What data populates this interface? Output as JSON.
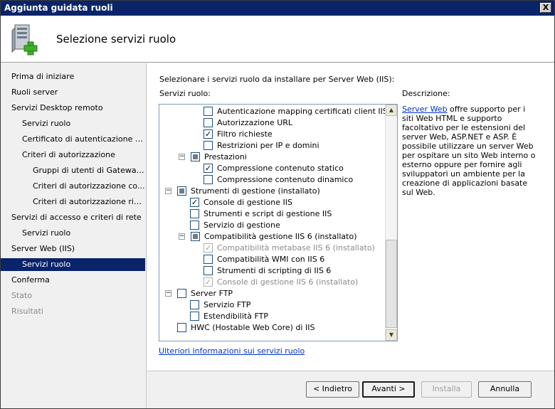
{
  "window": {
    "title": "Aggiunta guidata ruoli",
    "close_glyph": "X"
  },
  "header": {
    "title": "Selezione servizi ruolo",
    "icon": "server-add-icon"
  },
  "nav": {
    "items": [
      {
        "label": "Prima di iniziare",
        "state": "normal"
      },
      {
        "label": "Ruoli server",
        "state": "normal"
      },
      {
        "label": "Servizi Desktop remoto",
        "state": "normal"
      },
      {
        "label": "Servizi ruolo",
        "state": "normal"
      },
      {
        "label": "Certificato di autenticazione s...",
        "state": "normal"
      },
      {
        "label": "Criteri di autorizzazione",
        "state": "normal"
      },
      {
        "label": "Gruppi di utenti di Gateway...",
        "state": "normal"
      },
      {
        "label": "Criteri di autorizzazione co...",
        "state": "normal"
      },
      {
        "label": "Criteri di autorizzazione ris...",
        "state": "normal"
      },
      {
        "label": "Servizi di accesso e criteri di rete",
        "state": "normal"
      },
      {
        "label": "Servizi ruolo",
        "state": "normal"
      },
      {
        "label": "Server Web (IIS)",
        "state": "normal"
      },
      {
        "label": "Servizi ruolo",
        "state": "selected"
      },
      {
        "label": "Conferma",
        "state": "normal"
      },
      {
        "label": "Stato",
        "state": "disabled"
      },
      {
        "label": "Risultati",
        "state": "disabled"
      }
    ]
  },
  "main": {
    "instruction": "Selezionare i servizi ruolo da installare per Server Web (IIS):",
    "services_label": "Servizi ruolo:",
    "description_label": "Descrizione:",
    "description_link": "Server Web",
    "description_text": " offre supporto per i siti Web HTML e supporto facoltativo per le estensioni del server Web, ASP.NET e ASP. È possibile utilizzare un server Web per ospitare un sito Web interno o esterno oppure per fornire agli sviluppatori un ambiente per la creazione di applicazioni basate sul Web.",
    "more_info_link": "Ulteriori informazioni sui servizi ruolo"
  },
  "tree": {
    "items": [
      {
        "label": "Autenticazione mapping certificati client IIS",
        "check": "unchecked",
        "expander": "",
        "disabled": false
      },
      {
        "label": "Autorizzazione URL",
        "check": "unchecked",
        "expander": "",
        "disabled": false
      },
      {
        "label": "Filtro richieste",
        "check": "checked",
        "expander": "",
        "disabled": false
      },
      {
        "label": "Restrizioni per IP e domini",
        "check": "unchecked",
        "expander": "",
        "disabled": false
      },
      {
        "label": "Prestazioni",
        "check": "partial",
        "expander": "−",
        "disabled": false
      },
      {
        "label": "Compressione contenuto statico",
        "check": "checked",
        "expander": "",
        "disabled": false
      },
      {
        "label": "Compressione contenuto dinamico",
        "check": "unchecked",
        "expander": "",
        "disabled": false
      },
      {
        "label": "Strumenti di gestione  (installato)",
        "check": "partial",
        "expander": "−",
        "disabled": false
      },
      {
        "label": "Console di gestione IIS",
        "check": "checked",
        "expander": "",
        "disabled": false
      },
      {
        "label": "Strumenti e script di gestione IIS",
        "check": "unchecked",
        "expander": "",
        "disabled": false
      },
      {
        "label": "Servizio di gestione",
        "check": "unchecked",
        "expander": "",
        "disabled": false
      },
      {
        "label": "Compatibilità gestione IIS 6  (installato)",
        "check": "partial",
        "expander": "−",
        "disabled": false
      },
      {
        "label": "Compatibilità metabase IIS 6  (installato)",
        "check": "checked",
        "expander": "",
        "disabled": true
      },
      {
        "label": "Compatibilità WMI con IIS 6",
        "check": "unchecked",
        "expander": "",
        "disabled": false
      },
      {
        "label": "Strumenti di scripting di IIS 6",
        "check": "unchecked",
        "expander": "",
        "disabled": false
      },
      {
        "label": "Console di gestione IIS 6  (installato)",
        "check": "checked",
        "expander": "",
        "disabled": true
      },
      {
        "label": "Server FTP",
        "check": "unchecked",
        "expander": "−",
        "disabled": false
      },
      {
        "label": "Servizio FTP",
        "check": "unchecked",
        "expander": "",
        "disabled": false
      },
      {
        "label": "Estendibilità FTP",
        "check": "unchecked",
        "expander": "",
        "disabled": false
      },
      {
        "label": "HWC (Hostable Web Core) di IIS",
        "check": "unchecked",
        "expander": "",
        "disabled": false
      }
    ]
  },
  "buttons": {
    "back": "< Indietro",
    "next": "Avanti >",
    "install": "Installa",
    "cancel": "Annulla"
  }
}
